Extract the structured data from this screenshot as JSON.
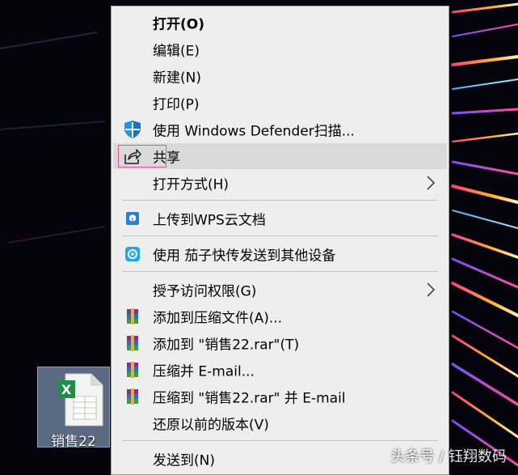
{
  "desktop": {
    "file_name": "销售22",
    "file_icon": "excel-file-icon",
    "file_icon_letter": "X",
    "background_accent_colors": [
      "#ff3d7f",
      "#ffb02e",
      "#7a4dff",
      "#3fb6ff"
    ]
  },
  "context_menu": {
    "items": [
      {
        "label": "打开(O)",
        "bold": true,
        "icon": ""
      },
      {
        "label": "编辑(E)",
        "icon": ""
      },
      {
        "label": "新建(N)",
        "icon": ""
      },
      {
        "label": "打印(P)",
        "icon": ""
      },
      {
        "label": "使用 Windows Defender扫描...",
        "icon": "windows-defender-shield-icon"
      },
      {
        "label": "共享",
        "icon": "share-icon",
        "hovered": true,
        "highlight_color": "#e0569c"
      },
      {
        "label": "打开方式(H)",
        "icon": "",
        "submenu": true
      },
      {
        "label": "上传到WPS云文档",
        "icon": "wps-cloud-icon"
      },
      {
        "label": "使用 茄子快传发送到其他设备",
        "icon": "shareit-icon"
      },
      {
        "label": "授予访问权限(G)",
        "icon": "",
        "submenu": true
      },
      {
        "label": "添加到压缩文件(A)...",
        "icon": "winrar-icon"
      },
      {
        "label": "添加到 \"销售22.rar\"(T)",
        "icon": "winrar-icon"
      },
      {
        "label": "压缩并 E-mail...",
        "icon": "winrar-icon"
      },
      {
        "label": "压缩到 \"销售22.rar\" 并 E-mail",
        "icon": "winrar-icon"
      },
      {
        "label": "还原以前的版本(V)",
        "icon": ""
      },
      {
        "label": "发送到(N)",
        "icon": ""
      }
    ]
  },
  "watermark": "头条号 / 钰翔数码"
}
